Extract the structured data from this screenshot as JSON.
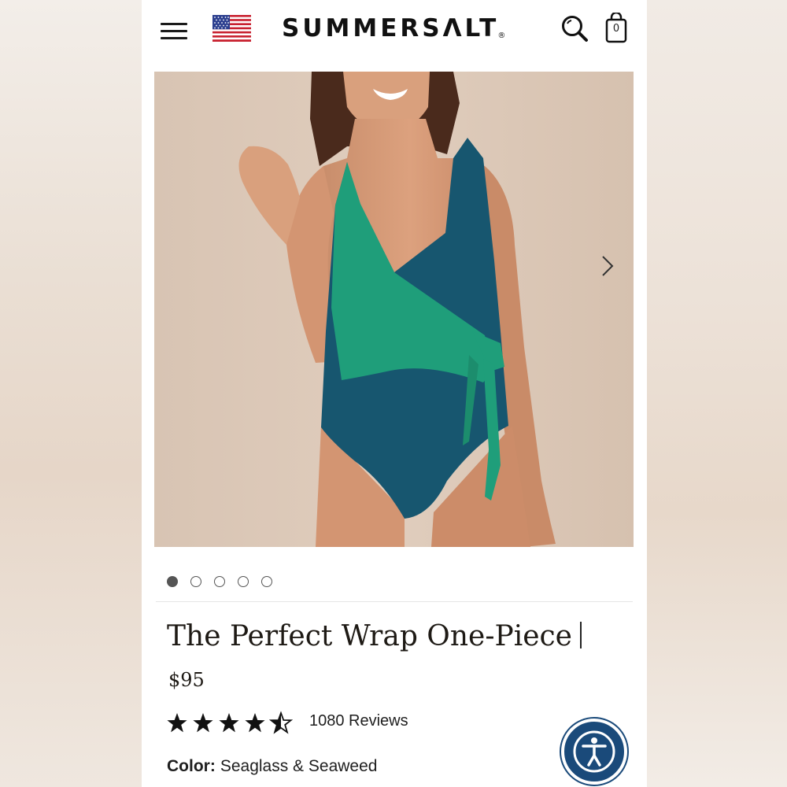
{
  "brand": {
    "name": "SUMMERSΛLT",
    "registered_mark": "®"
  },
  "header": {
    "menu_icon": "hamburger-icon",
    "flag_icon": "us-flag-icon",
    "search_icon": "search-icon",
    "cart_icon": "shopping-bag-icon",
    "cart_count": "0"
  },
  "gallery": {
    "next_icon": "chevron-right-icon",
    "slide_count": 5,
    "active_slide": 1,
    "swimsuit_colors": {
      "green": "#1f9e7a",
      "teal": "#17566f"
    }
  },
  "product": {
    "title": "The Perfect Wrap One-Piece",
    "price": "$95",
    "rating": 4.5,
    "rating_max": 5,
    "reviews_label": "1080 Reviews",
    "color_label": "Color:",
    "color_value": "Seaglass & Seaweed"
  },
  "accessibility": {
    "icon": "accessibility-icon",
    "color": "#1a4a7a"
  }
}
